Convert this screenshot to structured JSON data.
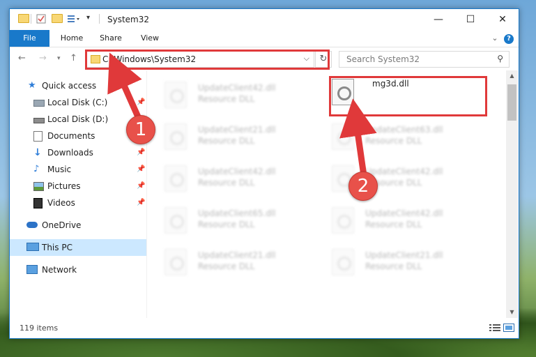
{
  "window": {
    "title": "System32",
    "controls": {
      "minimize": "—",
      "maximize": "☐",
      "close": "✕"
    }
  },
  "ribbon": {
    "tabs": [
      "File",
      "Home",
      "Share",
      "View"
    ],
    "collapse_glyph": "⌄",
    "help_glyph": "?"
  },
  "address": {
    "path": "C:\\Windows\\System32",
    "search_placeholder": "Search System32"
  },
  "nav": {
    "items": [
      {
        "label": "Quick access",
        "icon": "star-icon",
        "pinned": false
      },
      {
        "label": "Local Disk (C:)",
        "icon": "drive-icon",
        "pinned": true
      },
      {
        "label": "Local Disk (D:)",
        "icon": "drive-icon",
        "pinned": false
      },
      {
        "label": "Documents",
        "icon": "documents-icon",
        "pinned": false
      },
      {
        "label": "Downloads",
        "icon": "download-icon",
        "pinned": true
      },
      {
        "label": "Music",
        "icon": "music-icon",
        "pinned": true
      },
      {
        "label": "Pictures",
        "icon": "pictures-icon",
        "pinned": true
      },
      {
        "label": "Videos",
        "icon": "videos-icon",
        "pinned": true
      },
      {
        "label": "OneDrive",
        "icon": "cloud-icon",
        "pinned": false
      },
      {
        "label": "This PC",
        "icon": "computer-icon",
        "pinned": false,
        "selected": true
      },
      {
        "label": "Network",
        "icon": "network-icon",
        "pinned": false
      }
    ]
  },
  "files": {
    "left": [
      {
        "name": "UpdateClient42.dll",
        "type": "Resource DLL"
      },
      {
        "name": "UpdateClient21.dll",
        "type": "Resource DLL"
      },
      {
        "name": "UpdateClient42.dll",
        "type": "Resource DLL"
      },
      {
        "name": "UpdateClient65.dll",
        "type": "Resource DLL"
      },
      {
        "name": "UpdateClient21.dll",
        "type": "Resource DLL"
      }
    ],
    "right": [
      {
        "name": "mg3d.dll",
        "type": "",
        "highlighted": true
      },
      {
        "name": "UpdateClient63.dll",
        "type": "Resource DLL"
      },
      {
        "name": "UpdateClient42.dll",
        "type": "Resource DLL"
      },
      {
        "name": "UpdateClient42.dll",
        "type": "Resource DLL"
      },
      {
        "name": "UpdateClient21.dll",
        "type": "Resource DLL"
      }
    ]
  },
  "status": {
    "item_count": "119 items"
  },
  "annotations": {
    "step1": "1",
    "step2": "2",
    "color": "#e0393a"
  }
}
